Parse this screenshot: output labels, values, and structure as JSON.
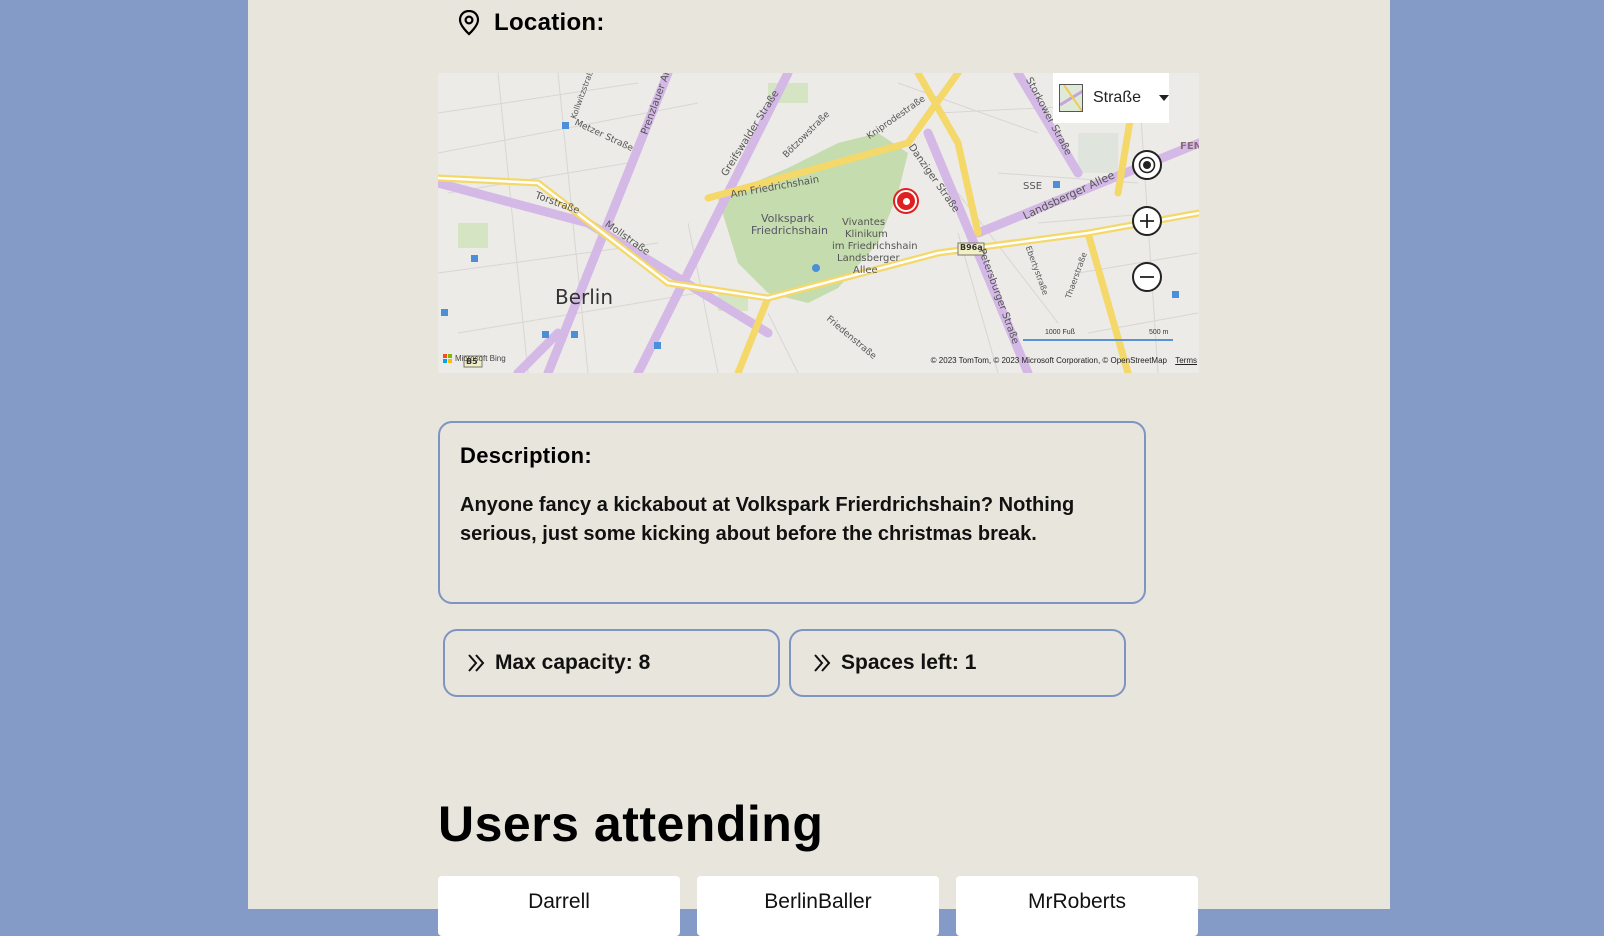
{
  "location": {
    "heading": "Location:",
    "map": {
      "style_label": "Straße",
      "city_label": "Berlin",
      "park_label": "Volkspark Friedrichshain",
      "park_label_line1": "Volkspark",
      "park_label_line2": "Friedrichshain",
      "hospital_lines": [
        "Vivantes",
        "Klinikum",
        "im Friedrichshain",
        "Landsberger",
        "Allee"
      ],
      "streets": [
        "Torstraße",
        "Mollstraße",
        "Am Friedrichshain",
        "Greifswalder Straße",
        "Prenzlauer Al",
        "Danziger Straße",
        "Landsberger Allee",
        "Petersburger Straße",
        "Storkower Straße",
        "Kniprodestraße",
        "Bötzowstraße",
        "Metzer Straße",
        "Friedenstraße",
        "Ebertystraße",
        "Thaerstraße",
        "Kollwitzstraße"
      ],
      "road_badges": [
        "B96a",
        "B5"
      ],
      "misc_labels": [
        "SSE",
        "FEN"
      ],
      "scale_ft": "1000 Fuß",
      "scale_m": "500 m",
      "attribution": "© 2023 TomTom, © 2023 Microsoft Corporation, © OpenStreetMap",
      "terms": "Terms",
      "bing": "Microsoft Bing",
      "controls": [
        "locate-me",
        "zoom-in",
        "zoom-out"
      ]
    }
  },
  "description": {
    "title": "Description:",
    "text": "Anyone fancy a kickabout at Volkspark Frierdrichshain? Nothing serious, just some kicking about before the christmas break."
  },
  "stats": {
    "max_capacity": "Max capacity: 8",
    "spaces_left": "Spaces left: 1"
  },
  "users": {
    "heading": "Users attending",
    "list": [
      "Darrell",
      "BerlinBaller",
      "MrRoberts"
    ]
  },
  "colors": {
    "outer_bg": "#849bc8",
    "page_bg": "#e8e6dc",
    "border": "#7e94c2",
    "pin": "#e02020"
  }
}
